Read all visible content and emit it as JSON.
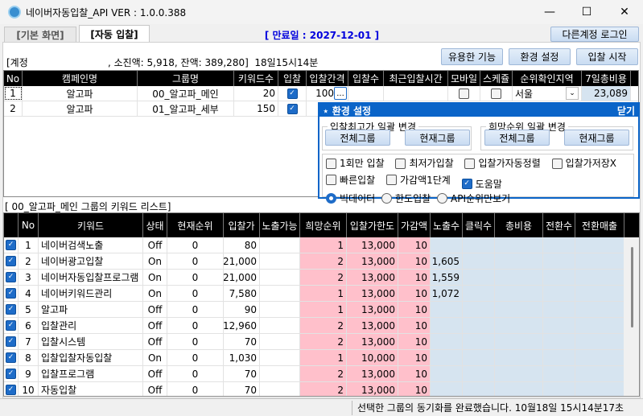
{
  "window": {
    "title": "네이버자동입찰_API VER : 1.0.0.388",
    "minimize": "—",
    "maximize": "☐",
    "close": "✕"
  },
  "tabs": [
    {
      "label": "[기본 화면]"
    },
    {
      "label": "[자동 입찰]"
    }
  ],
  "expiry": "[ 만료일 : 2027-12-01 ]",
  "other_login": "다른계정 로그인",
  "account_info": "[계정                          , 소진액: 5,918, 잔액: 389,280]  18일15시14분",
  "toolbar": {
    "useful": "유용한 기능",
    "settings": "환경 설정",
    "start": "입찰 시작"
  },
  "group_grid": {
    "headers": [
      "No",
      "캠페인명",
      "그룹명",
      "키워드수",
      "입찰",
      "입찰간격",
      "입찰수",
      "최근입찰시간",
      "모바일",
      "스케쥴",
      "순위확인지역",
      "7일총비용"
    ],
    "rows": [
      {
        "no": "1",
        "campaign": "알고파",
        "group": "00_알고파_메인",
        "keywords": "20",
        "bid": true,
        "interval": "100",
        "interval_btn": "...",
        "bids": "",
        "last": "",
        "mobile": false,
        "schedule": false,
        "region": "서울",
        "cost7": "23,089"
      },
      {
        "no": "2",
        "campaign": "알고파",
        "group": "01_알고파_세부",
        "keywords": "150",
        "bid": true
      }
    ]
  },
  "settings_panel": {
    "title": "환경 설정",
    "close": "닫기",
    "max_bid_group": {
      "legend": "입찰최고가 일괄 변경",
      "all": "전체그룹",
      "current": "현재그룹"
    },
    "rank_group": {
      "legend": "희망순위 일괄 변경",
      "all": "전체그룹",
      "current": "현재그룹"
    },
    "checks": [
      {
        "label": "1회만 입찰",
        "checked": false
      },
      {
        "label": "최저가입찰",
        "checked": false
      },
      {
        "label": "입찰가자동정렬",
        "checked": false
      },
      {
        "label": "입찰가저장X",
        "checked": false
      },
      {
        "label": "빠른입찰",
        "checked": false
      },
      {
        "label": "가감액1단계",
        "checked": false
      },
      {
        "label": "도움말",
        "checked": true
      }
    ],
    "radios": [
      {
        "label": "빅데이터",
        "selected": true
      },
      {
        "label": "한도입찰",
        "selected": false
      },
      {
        "label": "API순위만보기",
        "selected": false
      }
    ]
  },
  "keyword_list_title": "[ 00_알고파_메인 그룹의 키워드 리스트]",
  "keyword_grid": {
    "headers": [
      "",
      "No",
      "키워드",
      "상태",
      "현재순위",
      "입찰가",
      "노출가능",
      "희망순위",
      "입찰가한도",
      "가감액",
      "노출수",
      "클릭수",
      "총비용",
      "전환수",
      "전환매출"
    ],
    "rows": [
      [
        "1",
        "네이버검색노출",
        "Off",
        "0",
        "80",
        "",
        "1",
        "13,000",
        "10",
        "",
        "",
        "",
        "",
        ""
      ],
      [
        "2",
        "네이버광고입찰",
        "On",
        "0",
        "21,000",
        "",
        "2",
        "13,000",
        "10",
        "1,605",
        "",
        "",
        "",
        ""
      ],
      [
        "3",
        "네이버자동입찰프로그램",
        "On",
        "0",
        "21,000",
        "",
        "2",
        "13,000",
        "10",
        "1,559",
        "",
        "",
        "",
        ""
      ],
      [
        "4",
        "네이버키워드관리",
        "On",
        "0",
        "7,580",
        "",
        "1",
        "13,000",
        "10",
        "1,072",
        "",
        "",
        "",
        ""
      ],
      [
        "5",
        "알고파",
        "Off",
        "0",
        "90",
        "",
        "1",
        "13,000",
        "10",
        "",
        "",
        "",
        "",
        ""
      ],
      [
        "6",
        "입찰관리",
        "Off",
        "0",
        "12,960",
        "",
        "2",
        "13,000",
        "10",
        "",
        "",
        "",
        "",
        ""
      ],
      [
        "7",
        "입찰시스템",
        "Off",
        "0",
        "70",
        "",
        "2",
        "13,000",
        "10",
        "",
        "",
        "",
        "",
        ""
      ],
      [
        "8",
        "입찰입찰자동입찰",
        "On",
        "0",
        "1,030",
        "",
        "1",
        "10,000",
        "10",
        "",
        "",
        "",
        "",
        ""
      ],
      [
        "9",
        "입찰프로그램",
        "Off",
        "0",
        "70",
        "",
        "2",
        "13,000",
        "10",
        "",
        "",
        "",
        "",
        ""
      ],
      [
        "10",
        "자동입찰",
        "Off",
        "0",
        "70",
        "",
        "2",
        "13,000",
        "10",
        "",
        "",
        "",
        "",
        ""
      ]
    ]
  },
  "status": "선택한 그룹의 동기화를 완료했습니다. 10월18일 15시14분17초"
}
